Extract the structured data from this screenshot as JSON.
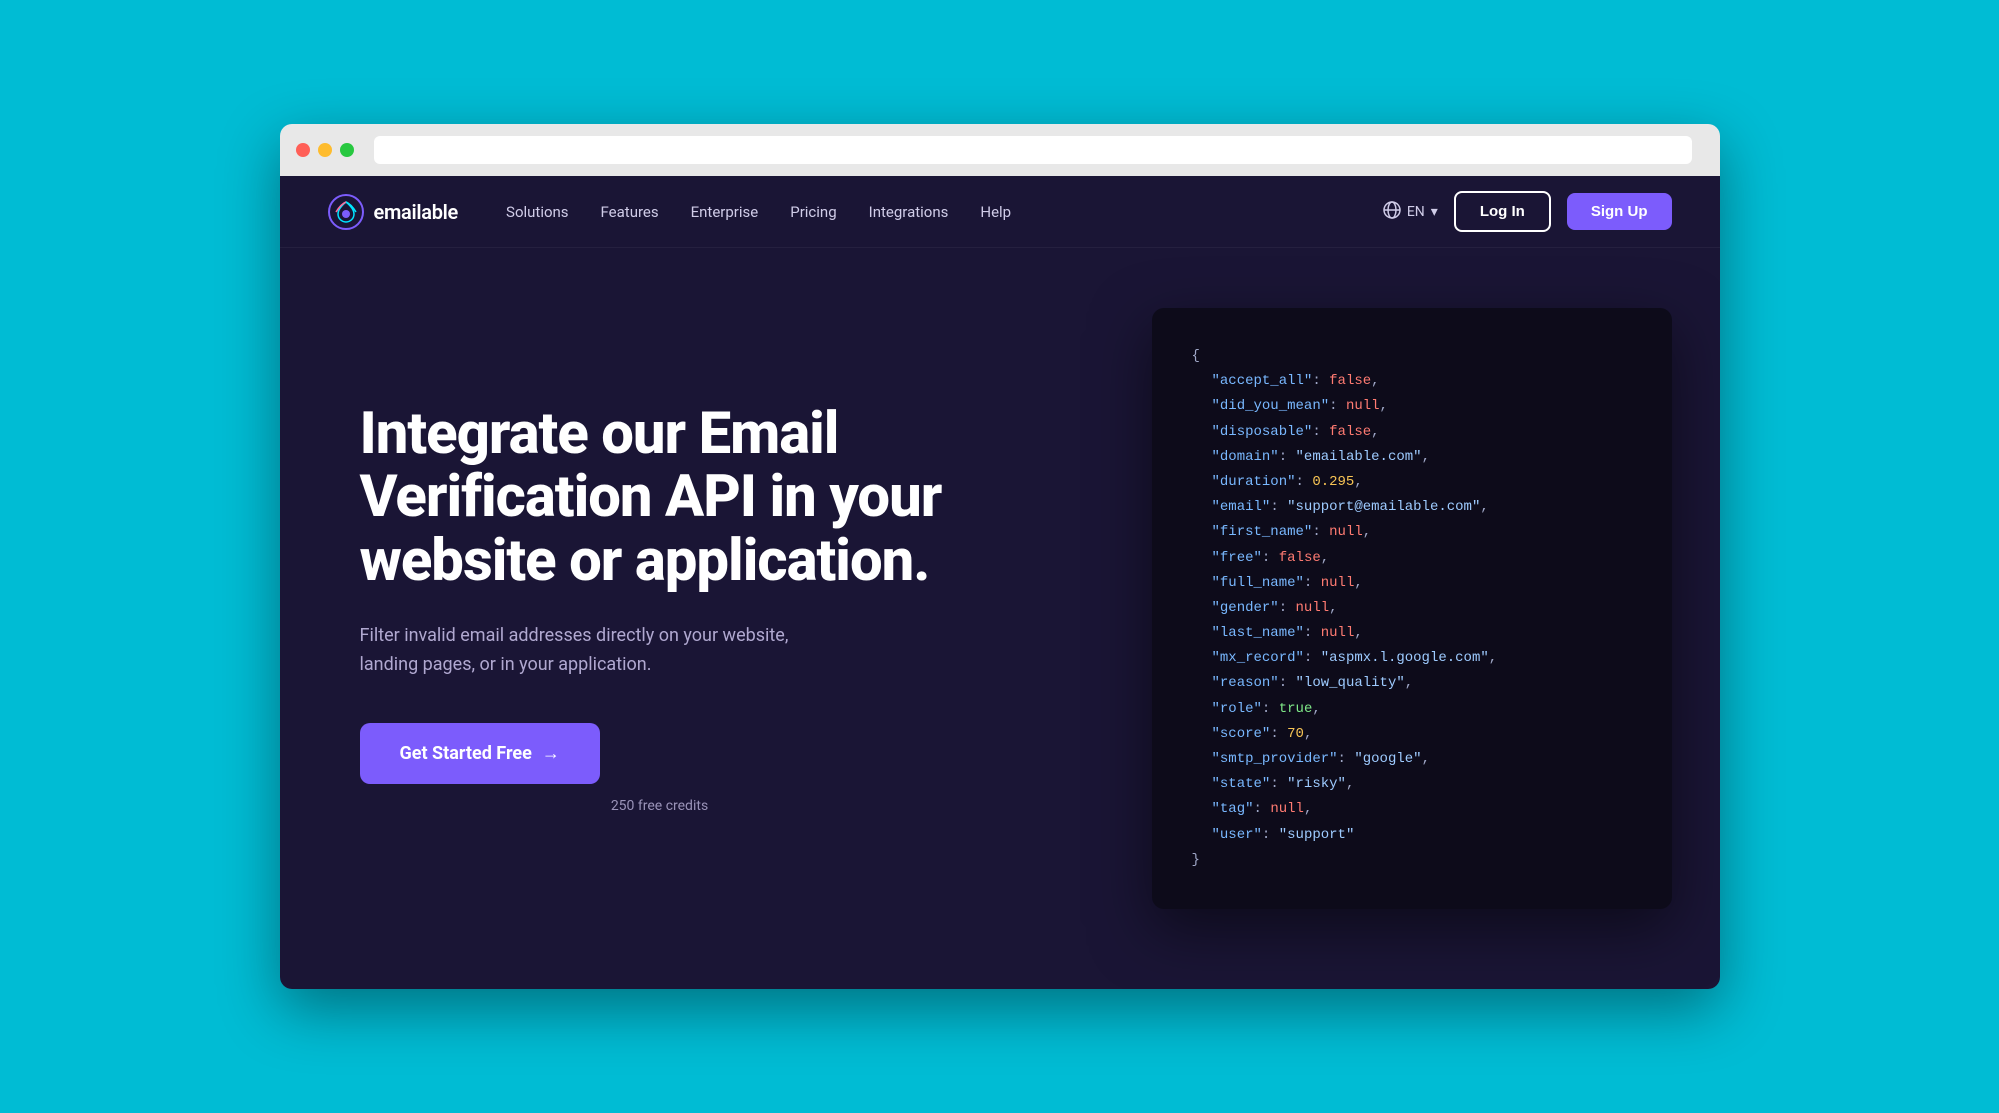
{
  "browser": {
    "traffic_lights": [
      "red",
      "yellow",
      "green"
    ]
  },
  "nav": {
    "logo_text": "emailable",
    "links": [
      {
        "label": "Solutions",
        "id": "solutions"
      },
      {
        "label": "Features",
        "id": "features"
      },
      {
        "label": "Enterprise",
        "id": "enterprise"
      },
      {
        "label": "Pricing",
        "id": "pricing"
      },
      {
        "label": "Integrations",
        "id": "integrations"
      },
      {
        "label": "Help",
        "id": "help"
      }
    ],
    "lang": "EN",
    "login_label": "Log In",
    "signup_label": "Sign Up"
  },
  "hero": {
    "title": "Integrate our Email Verification API in your website or application.",
    "subtitle": "Filter invalid email addresses directly on your website, landing pages, or in your application.",
    "cta_label": "Get Started Free",
    "cta_arrow": "→",
    "free_credits": "250 free credits"
  },
  "code": {
    "lines": [
      {
        "type": "brace",
        "text": "{"
      },
      {
        "type": "key-false",
        "key": "\"accept_all\"",
        "value": "false,"
      },
      {
        "type": "key-null",
        "key": "\"did_you_mean\"",
        "value": "null,"
      },
      {
        "type": "key-false",
        "key": "\"disposable\"",
        "value": "false,"
      },
      {
        "type": "key-string",
        "key": "\"domain\"",
        "value": "\"emailable.com\","
      },
      {
        "type": "key-number",
        "key": "\"duration\"",
        "value": "0.295,"
      },
      {
        "type": "key-string",
        "key": "\"email\"",
        "value": "\"support@emailable.com\","
      },
      {
        "type": "key-null",
        "key": "\"first_name\"",
        "value": "null,"
      },
      {
        "type": "key-false",
        "key": "\"free\"",
        "value": "false,"
      },
      {
        "type": "key-null",
        "key": "\"full_name\"",
        "value": "null,"
      },
      {
        "type": "key-null",
        "key": "\"gender\"",
        "value": "null,"
      },
      {
        "type": "key-null",
        "key": "\"last_name\"",
        "value": "null,"
      },
      {
        "type": "key-string",
        "key": "\"mx_record\"",
        "value": "\"aspmx.l.google.com\","
      },
      {
        "type": "key-string",
        "key": "\"reason\"",
        "value": "\"low_quality\","
      },
      {
        "type": "key-true",
        "key": "\"role\"",
        "value": "true,"
      },
      {
        "type": "key-number",
        "key": "\"score\"",
        "value": "70,"
      },
      {
        "type": "key-string",
        "key": "\"smtp_provider\"",
        "value": "\"google\","
      },
      {
        "type": "key-string",
        "key": "\"state\"",
        "value": "\"risky\","
      },
      {
        "type": "key-null",
        "key": "\"tag\"",
        "value": "null,"
      },
      {
        "type": "key-string",
        "key": "\"user\"",
        "value": "\"support\""
      },
      {
        "type": "brace",
        "text": "}"
      }
    ]
  },
  "colors": {
    "bg_dark": "#1a1535",
    "accent_purple": "#7c5cfc",
    "code_bg": "#0d0b1a",
    "teal_border": "#00bcd4"
  }
}
